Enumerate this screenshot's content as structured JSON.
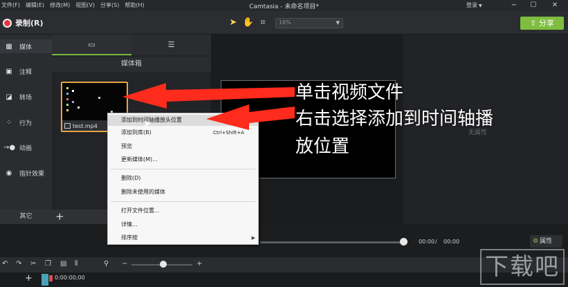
{
  "menubar": {
    "items": [
      "文件(F)",
      "编辑(E)",
      "修改(M)",
      "视图(V)",
      "分享(S)",
      "帮助(H)"
    ],
    "window_title": "Camtasia - 未命名项目*",
    "login_label": "登录"
  },
  "toolbar": {
    "record_label": "录制(R)",
    "zoom_value": "16%",
    "share_label": "分享"
  },
  "rail": {
    "items": [
      {
        "label": "媒体",
        "icon": "film-icon"
      },
      {
        "label": "注释",
        "icon": "annotation-icon"
      },
      {
        "label": "转场",
        "icon": "transition-icon"
      },
      {
        "label": "行为",
        "icon": "behavior-icon"
      },
      {
        "label": "动画",
        "icon": "animation-icon"
      },
      {
        "label": "指针效果",
        "icon": "cursor-effect-icon"
      }
    ],
    "other_label": "其它"
  },
  "media_bin": {
    "title": "媒体箱",
    "file_name": "test.mp4"
  },
  "context_menu": {
    "items": [
      {
        "label": "添加到时间轴播放头位置",
        "shortcut": ""
      },
      {
        "label": "添加到库(B)",
        "shortcut": "Ctrl+Shift+A"
      },
      {
        "label": "预览",
        "shortcut": ""
      },
      {
        "label": "更新媒体(M)...",
        "shortcut": ""
      },
      {
        "label": "删除(D)",
        "shortcut": ""
      },
      {
        "label": "删除未使用的媒体",
        "shortcut": ""
      },
      {
        "label": "打开文件位置...",
        "shortcut": ""
      },
      {
        "label": "详情...",
        "shortcut": ""
      },
      {
        "label": "排序按",
        "shortcut": ""
      }
    ]
  },
  "properties": {
    "empty_text": "无属性",
    "button_label": "属性"
  },
  "playback": {
    "current_time": "00:00",
    "separator": "/",
    "total_time": "00:00"
  },
  "timeline": {
    "playhead_time": "0:00:00;00"
  },
  "annotations": {
    "line1": "单击视频文件",
    "line2": "右击选择添加到时间轴播",
    "line3": "放位置"
  },
  "watermark": "下载吧",
  "colors": {
    "accent_green": "#7ebd3f",
    "record_red": "#e63440",
    "arrow_red": "#ff2b1c",
    "thumb_border": "#e6a64a"
  }
}
